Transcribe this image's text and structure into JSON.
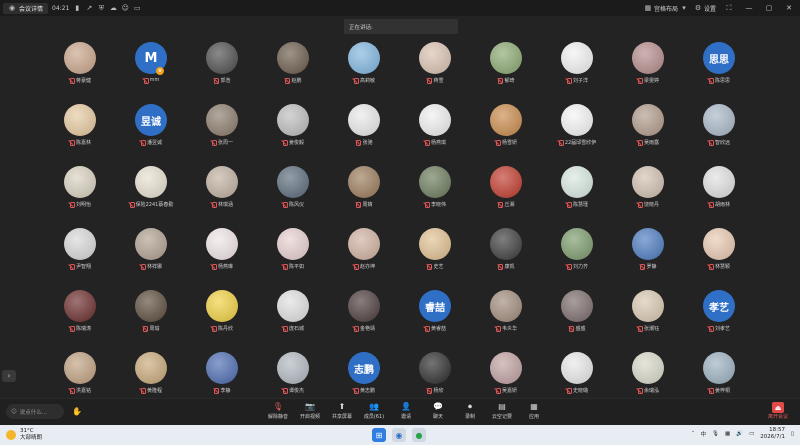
{
  "titlebar": {
    "meeting_tab": "会议详情",
    "timer": "04:21",
    "layout_label": "宫格布局",
    "settings_label": "设置"
  },
  "speaking": "正在讲话:",
  "participants": [
    {
      "name": "蒋豪健",
      "type": "photo",
      "bg": "#c9a58a"
    },
    {
      "name": "mm",
      "type": "text",
      "text": "M",
      "host": true
    },
    {
      "name": "郭浩",
      "type": "photo",
      "bg": "#4b4b4b"
    },
    {
      "name": "赵鹏",
      "type": "photo",
      "bg": "#6a5a4a"
    },
    {
      "name": "高莉敏",
      "type": "photo",
      "bg": "#7fb6e0"
    },
    {
      "name": "蒋雪",
      "type": "photo",
      "bg": "#d9c2b0"
    },
    {
      "name": "郁琦",
      "type": "photo",
      "bg": "#8aa870"
    },
    {
      "name": "刘子洋",
      "type": "photo",
      "bg": "#f2f2f2"
    },
    {
      "name": "梁雯婷",
      "type": "photo",
      "bg": "#b48a8a"
    },
    {
      "name": "陈思思",
      "type": "text",
      "text": "思思"
    },
    {
      "name": "陈嘉林",
      "type": "photo",
      "bg": "#e6c9a0"
    },
    {
      "name": "潘昱诚",
      "type": "text",
      "text": "昱诚"
    },
    {
      "name": "张周一",
      "type": "photo",
      "bg": "#8a7a6a"
    },
    {
      "name": "姜俊毅",
      "type": "photo",
      "bg": "#bdbdbd"
    },
    {
      "name": "张驰",
      "type": "photo",
      "bg": "#eaeaea"
    },
    {
      "name": "杨燕琪",
      "type": "photo",
      "bg": "#f0f0f0"
    },
    {
      "name": "杨雪妍",
      "type": "photo",
      "bg": "#c98a4a"
    },
    {
      "name": "22届邱雪欣伊",
      "type": "photo",
      "bg": "#f5f5f5"
    },
    {
      "name": "吴雨露",
      "type": "photo",
      "bg": "#b09a8a"
    },
    {
      "name": "智欣远",
      "type": "photo",
      "bg": "#a7b7c7"
    },
    {
      "name": "刘明怡",
      "type": "photo",
      "bg": "#d9d0c0"
    },
    {
      "name": "保险2241蔡春勤",
      "type": "photo",
      "bg": "#e8e0d0"
    },
    {
      "name": "林琪涵",
      "type": "photo",
      "bg": "#c0b0a0"
    },
    {
      "name": "陈风仪",
      "type": "photo",
      "bg": "#5a6a7a"
    },
    {
      "name": "周婧",
      "type": "photo",
      "bg": "#9a7a5a"
    },
    {
      "name": "李晓伟",
      "type": "photo",
      "bg": "#6a7a5a"
    },
    {
      "name": "丘湘",
      "type": "photo",
      "bg": "#c0392b"
    },
    {
      "name": "陈慧瑾",
      "type": "photo",
      "bg": "#d8e8e0"
    },
    {
      "name": "饶晓丹",
      "type": "photo",
      "bg": "#d0c0b0"
    },
    {
      "name": "胡雨林",
      "type": "photo",
      "bg": "#e0e0e0"
    },
    {
      "name": "尹智翔",
      "type": "photo",
      "bg": "#d8d8d8"
    },
    {
      "name": "林祥娜",
      "type": "photo",
      "bg": "#b0a090"
    },
    {
      "name": "杨燕琳",
      "type": "photo",
      "bg": "#f0e6e6"
    },
    {
      "name": "陈平如",
      "type": "photo",
      "bg": "#e8d0d0"
    },
    {
      "name": "赵亦坤",
      "type": "photo",
      "bg": "#d0b0a0"
    },
    {
      "name": "史艺",
      "type": "photo",
      "bg": "#e0c090"
    },
    {
      "name": "康凯",
      "type": "photo",
      "bg": "#3a3a3a"
    },
    {
      "name": "刘力齐",
      "type": "photo",
      "bg": "#7a9a6a"
    },
    {
      "name": "罗静",
      "type": "photo",
      "bg": "#4a7ac0"
    },
    {
      "name": "林慧颖",
      "type": "photo",
      "bg": "#e8c8b0"
    },
    {
      "name": "陈瑞涛",
      "type": "photo",
      "bg": "#6a2a2a"
    },
    {
      "name": "周瑜",
      "type": "photo",
      "bg": "#5a4a3a"
    },
    {
      "name": "陈丹欣",
      "type": "photo",
      "bg": "#f0d040"
    },
    {
      "name": "庞石城",
      "type": "photo",
      "bg": "#e0e0e0"
    },
    {
      "name": "金艳靖",
      "type": "photo",
      "bg": "#4a3a3a"
    },
    {
      "name": "黄睿喆",
      "type": "text",
      "text": "睿喆"
    },
    {
      "name": "韦炎华",
      "type": "photo",
      "bg": "#a08a7a"
    },
    {
      "name": "盛盛",
      "type": "photo",
      "bg": "#7a6a6a"
    },
    {
      "name": "张潮钰",
      "type": "photo",
      "bg": "#d8c8b0"
    },
    {
      "name": "刘孝艺",
      "type": "text",
      "text": "孝艺"
    },
    {
      "name": "洪嘉铭",
      "type": "photo",
      "bg": "#c0a080"
    },
    {
      "name": "黄隆程",
      "type": "photo",
      "bg": "#c8a878"
    },
    {
      "name": "李静",
      "type": "photo",
      "bg": "#4a6ab0"
    },
    {
      "name": "谭俊杰",
      "type": "photo",
      "bg": "#b0b8c0"
    },
    {
      "name": "黄志鹏",
      "type": "text",
      "text": "志鹏"
    },
    {
      "name": "杨欣",
      "type": "photo",
      "bg": "#2a2a2a"
    },
    {
      "name": "吴嘉妍",
      "type": "photo",
      "bg": "#c0a0a0"
    },
    {
      "name": "史晓璐",
      "type": "photo",
      "bg": "#e8e8e8"
    },
    {
      "name": "余瑞泓",
      "type": "photo",
      "bg": "#d8d8c8"
    },
    {
      "name": "姜梓桐",
      "type": "photo",
      "bg": "#9ab0c0"
    }
  ],
  "toolbar": {
    "chat_placeholder": "说点什么...",
    "items": [
      {
        "label": "解除静音",
        "icon": "mic-muted-icon",
        "glyph": "🎙",
        "red": true
      },
      {
        "label": "开启视频",
        "icon": "camera-off-icon",
        "glyph": "📷",
        "red": true
      },
      {
        "label": "共享屏幕",
        "icon": "share-screen-icon",
        "glyph": "⬆"
      },
      {
        "label": "成员(61)",
        "icon": "members-icon",
        "glyph": "👥"
      },
      {
        "label": "邀请",
        "icon": "invite-icon",
        "glyph": "👤"
      },
      {
        "label": "聊天",
        "icon": "chat-icon",
        "glyph": "💬"
      },
      {
        "label": "录制",
        "icon": "record-icon",
        "glyph": "⏺"
      },
      {
        "label": "云空记要",
        "icon": "notes-icon",
        "glyph": "▤"
      },
      {
        "label": "应用",
        "icon": "apps-icon",
        "glyph": "▦"
      }
    ],
    "end_label": "离开会议"
  },
  "taskbar": {
    "temp": "31°C",
    "weather": "大部晴朗",
    "time": "18:57",
    "date": "2026/7/1"
  }
}
